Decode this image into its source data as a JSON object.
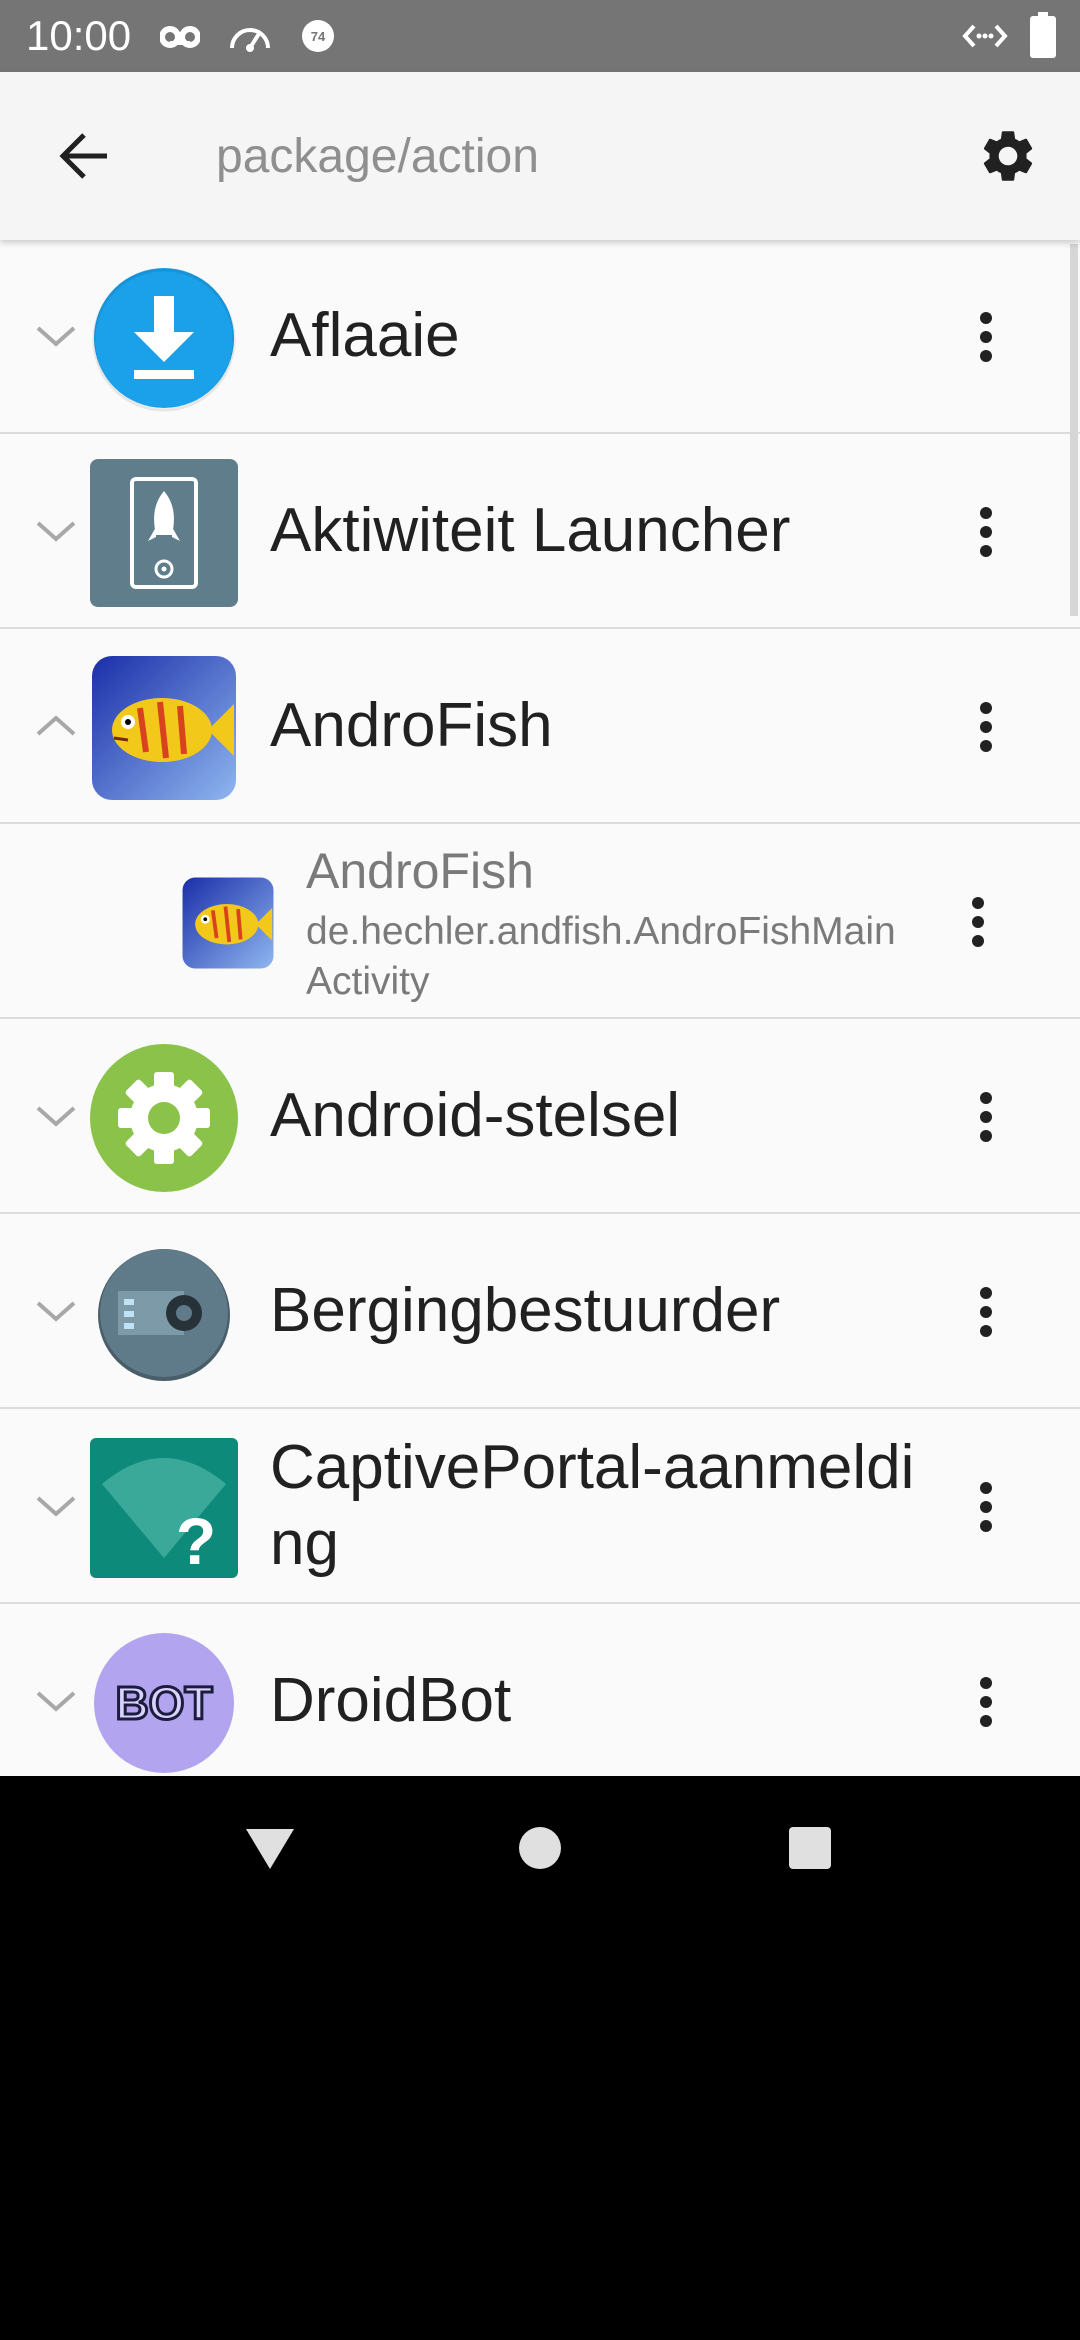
{
  "status_bar": {
    "time": "10:00",
    "notification_badge": "74",
    "icons": [
      "voicemail-icon",
      "speedometer-icon",
      "notification-badge-icon",
      "code-icon",
      "battery-icon"
    ]
  },
  "app_bar": {
    "search_placeholder": "package/action",
    "search_value": "",
    "icons": [
      "back-arrow-icon",
      "gear-icon"
    ]
  },
  "list": {
    "items": [
      {
        "label": "Aflaaie",
        "expanded": false,
        "icon": "download-icon"
      },
      {
        "label": "Aktiwiteit Launcher",
        "expanded": false,
        "icon": "rocket-icon"
      },
      {
        "label": "AndroFish",
        "expanded": true,
        "icon": "fish-icon",
        "children": [
          {
            "title": "AndroFish",
            "subtitle": "de.hechler.andfish.AndroFishMainActivity",
            "icon": "fish-icon"
          }
        ]
      },
      {
        "label": "Android-stelsel",
        "expanded": false,
        "icon": "gear-icon"
      },
      {
        "label": "Bergingbestuurder",
        "expanded": false,
        "icon": "storage-icon"
      },
      {
        "label": "CaptivePortal-aanmelding",
        "expanded": false,
        "icon": "wifi-question-icon"
      },
      {
        "label": "DroidBot",
        "expanded": false,
        "icon": "bot-icon"
      }
    ]
  },
  "bot_icon_text": "BOT",
  "colors": {
    "status_bar": "#757575",
    "app_bar": "#f5f5f5",
    "list_background": "#fafafa",
    "divider": "#dcdcdc",
    "primary_text": "#212121",
    "secondary_text": "#7a7a7a"
  }
}
